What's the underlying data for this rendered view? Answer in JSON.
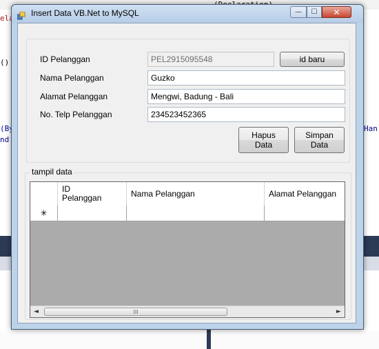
{
  "window": {
    "title": "Insert Data VB.Net to MySQL",
    "minimize_glyph": "—",
    "maximize_glyph": "☐",
    "close_glyph": "✕"
  },
  "form": {
    "id_label": "ID Pelanggan",
    "id_value": "PEL2915095548",
    "nama_label": "Nama Pelanggan",
    "nama_value": "Guzko",
    "alamat_label": "Alamat Pelanggan",
    "alamat_value": "Mengwi, Badung - Bali",
    "telp_label": "No. Telp Pelanggan",
    "telp_value": "234523452365",
    "id_baru_button": "id baru",
    "hapus_button_line1": "Hapus",
    "hapus_button_line2": "Data",
    "simpan_button_line1": "Simpan",
    "simpan_button_line2": "Data"
  },
  "group": {
    "label": "tampil data"
  },
  "grid": {
    "columns": [
      "ID\nPelanggan",
      "Nama Pelanggan",
      "Alamat Pelanggan"
    ],
    "new_row_marker": "✳",
    "scroll_left": "◄",
    "scroll_right": "►",
    "scroll_grip": "III"
  },
  "background": {
    "left_text_1": "ela",
    "left_text_2": "()",
    "left_text_3": "(By",
    "left_text_4": "nd",
    "right_text_1": "Han",
    "top_text": "(Declaration)"
  },
  "colors": {
    "close_button": "#c8472f",
    "window_frame": "#bcd3ea",
    "grid_background": "#ababab"
  }
}
